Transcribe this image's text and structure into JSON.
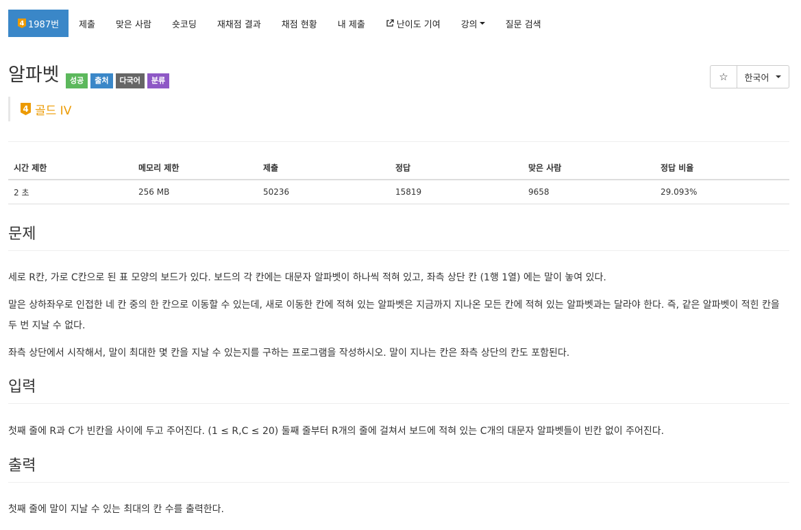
{
  "nav": {
    "items": [
      {
        "label": "1987번",
        "tier": "4",
        "active": true
      },
      {
        "label": "제출"
      },
      {
        "label": "맞은 사람"
      },
      {
        "label": "숏코딩"
      },
      {
        "label": "재채점 결과"
      },
      {
        "label": "채점 현황"
      },
      {
        "label": "내 제출"
      },
      {
        "label": "난이도 기여",
        "icon": "external-link-icon"
      },
      {
        "label": "강의",
        "dropdown": true
      },
      {
        "label": "질문 검색"
      }
    ]
  },
  "problem": {
    "title": "알파벳",
    "labels": [
      {
        "text": "성공",
        "color": "#5cb85c"
      },
      {
        "text": "출처",
        "color": "#3a87c8"
      },
      {
        "text": "다국어",
        "color": "#666666"
      },
      {
        "text": "분류",
        "color": "#8e58c6"
      }
    ],
    "tier": {
      "badge": "4",
      "text": "골드 IV",
      "color": "#ec9a00"
    },
    "language_button": "한국어",
    "star_icon": "star-icon"
  },
  "info_table": {
    "headers": [
      "시간 제한",
      "메모리 제한",
      "제출",
      "정답",
      "맞은 사람",
      "정답 비율"
    ],
    "values": [
      "2 초",
      "256 MB",
      "50236",
      "15819",
      "9658",
      "29.093%"
    ]
  },
  "sections": {
    "problem": {
      "heading": "문제",
      "paragraphs": [
        "세로 R칸, 가로 C칸으로 된 표 모양의 보드가 있다. 보드의 각 칸에는 대문자 알파벳이 하나씩 적혀 있고, 좌측 상단 칸 (1행 1열) 에는 말이 놓여 있다.",
        "말은 상하좌우로 인접한 네 칸 중의 한 칸으로 이동할 수 있는데, 새로 이동한 칸에 적혀 있는 알파벳은 지금까지 지나온 모든 칸에 적혀 있는 알파벳과는 달라야 한다. 즉, 같은 알파벳이 적힌 칸을 두 번 지날 수 없다.",
        "좌측 상단에서 시작해서, 말이 최대한 몇 칸을 지날 수 있는지를 구하는 프로그램을 작성하시오. 말이 지나는 칸은 좌측 상단의 칸도 포함된다."
      ]
    },
    "input": {
      "heading": "입력",
      "paragraphs": [
        "첫째 줄에 R과 C가 빈칸을 사이에 두고 주어진다. (1 ≤ R,C ≤ 20) 둘째 줄부터 R개의 줄에 걸쳐서 보드에 적혀 있는 C개의 대문자 알파벳들이 빈칸 없이 주어진다."
      ]
    },
    "output": {
      "heading": "출력",
      "paragraphs": [
        "첫째 줄에 말이 지날 수 있는 최대의 칸 수를 출력한다."
      ]
    }
  }
}
